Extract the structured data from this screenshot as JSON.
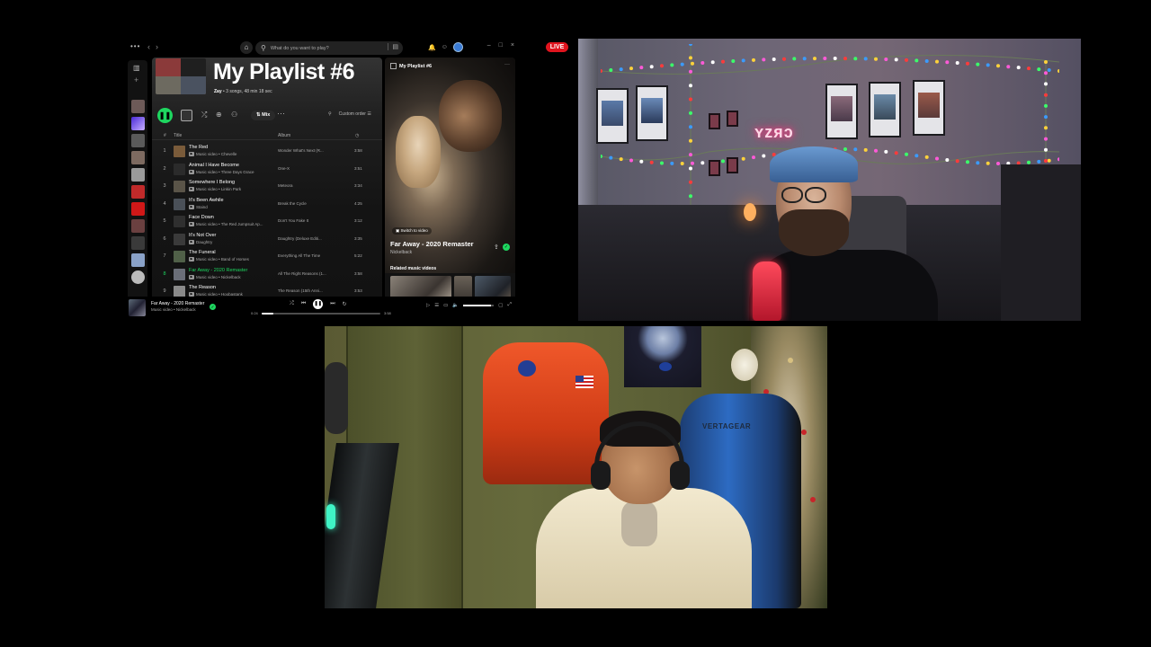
{
  "live_badge": "LIVE",
  "spotify": {
    "search_placeholder": "What do you want to play?",
    "playlist_title": "My Playlist #6",
    "meta_owner": "Zay",
    "meta_rest": " • 3 songs, 48 min 18 sec",
    "mix_label": "Mix",
    "sort_label": "Custom order",
    "columns": {
      "number": "#",
      "title": "Title",
      "album": "Album"
    },
    "tracks": [
      {
        "num": "1",
        "title": "The Red",
        "artist": "Music video • Chevelle",
        "album": "Wonder What's Next (R...",
        "duration": "3:58",
        "art": "#7a5b3a"
      },
      {
        "num": "2",
        "title": "Animal I Have Become",
        "artist": "Music video • Three Days Grace",
        "album": "One-X",
        "duration": "3:51",
        "art": "#2b2b2b"
      },
      {
        "num": "3",
        "title": "Somewhere I Belong",
        "artist": "Music video • Linkin Park",
        "album": "Meteora",
        "duration": "3:34",
        "art": "#5a5448"
      },
      {
        "num": "4",
        "title": "It's Been Awhile",
        "artist": "Staind",
        "album": "Break the Cycle",
        "duration": "4:25",
        "art": "#4a5058"
      },
      {
        "num": "5",
        "title": "Face Down",
        "artist": "Music video • The Red Jumpsuit Ap...",
        "album": "Don't You Fake It",
        "duration": "3:12",
        "art": "#2f2f2f"
      },
      {
        "num": "6",
        "title": "It's Not Over",
        "artist": "Daughtry",
        "album": "Daughtry (Deluxe Editi...",
        "duration": "3:35",
        "art": "#3a3a3a"
      },
      {
        "num": "7",
        "title": "The Funeral",
        "artist": "Music video • Band of Horses",
        "album": "Everything All The Time",
        "duration": "5:22",
        "art": "#506048"
      },
      {
        "num": "8",
        "title": "Far Away - 2020 Remaster",
        "artist": "Music video • Nickelback",
        "album": "All The Right Reasons (1...",
        "duration": "3:58",
        "art": "#6a6e78",
        "active": true
      },
      {
        "num": "9",
        "title": "The Reason",
        "artist": "Music video • Hoobastank",
        "album": "The Reason (15th Anni...",
        "duration": "3:53",
        "art": "#8a8a8a"
      }
    ],
    "now_playing": {
      "header": "My Playlist #6",
      "switch_label": "Switch to video",
      "song": "Far Away - 2020 Remaster",
      "artist": "Nickelback",
      "related": "Related music videos"
    },
    "player": {
      "title": "Far Away - 2020 Remaster",
      "subtitle": "Music video • Nickelback",
      "position": "0:24",
      "duration": "3:58",
      "progress": 0.1,
      "volume": 0.9
    }
  },
  "cam1": {
    "neon_sign": "ʏzяↄ"
  },
  "cam2": {
    "chair_brand": "VERTAGEAR"
  }
}
